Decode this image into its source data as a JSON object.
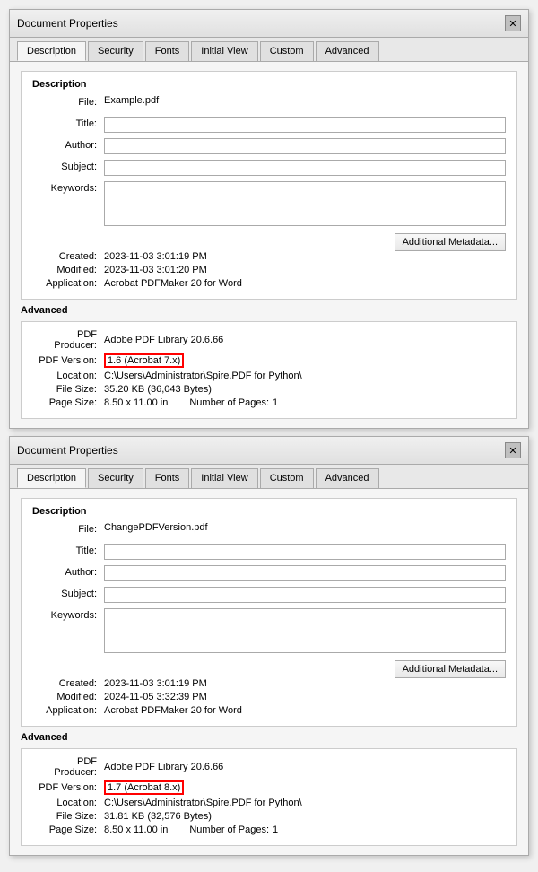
{
  "dialog1": {
    "title": "Document Properties",
    "tabs": [
      "Description",
      "Security",
      "Fonts",
      "Initial View",
      "Custom",
      "Advanced"
    ],
    "active_tab": "Description",
    "description_section_label": "Description",
    "fields": {
      "file_label": "File:",
      "file_value": "Example.pdf",
      "title_label": "Title:",
      "title_value": "",
      "author_label": "Author:",
      "author_value": "",
      "subject_label": "Subject:",
      "subject_value": "",
      "keywords_label": "Keywords:",
      "keywords_value": ""
    },
    "meta": {
      "created_label": "Created:",
      "created_value": "2023-11-03 3:01:19 PM",
      "modified_label": "Modified:",
      "modified_value": "2023-11-03 3:01:20 PM",
      "application_label": "Application:",
      "application_value": "Acrobat PDFMaker 20 for Word"
    },
    "additional_btn": "Additional Metadata...",
    "advanced_label": "Advanced",
    "advanced": {
      "pdf_producer_label": "PDF Producer:",
      "pdf_producer_value": "Adobe PDF Library 20.6.66",
      "pdf_version_label": "PDF Version:",
      "pdf_version_value": "1.6 (Acrobat 7.x)",
      "location_label": "Location:",
      "location_value": "C:\\Users\\Administrator\\Spire.PDF for Python\\",
      "file_size_label": "File Size:",
      "file_size_value": "35.20 KB (36,043 Bytes)",
      "page_size_label": "Page Size:",
      "page_size_value": "8.50 x 11.00 in",
      "number_of_pages_label": "Number of Pages:",
      "number_of_pages_value": "1"
    }
  },
  "dialog2": {
    "title": "Document Properties",
    "tabs": [
      "Description",
      "Security",
      "Fonts",
      "Initial View",
      "Custom",
      "Advanced"
    ],
    "active_tab": "Description",
    "description_section_label": "Description",
    "fields": {
      "file_label": "File:",
      "file_value": "ChangePDFVersion.pdf",
      "title_label": "Title:",
      "title_value": "",
      "author_label": "Author:",
      "author_value": "",
      "subject_label": "Subject:",
      "subject_value": "",
      "keywords_label": "Keywords:",
      "keywords_value": ""
    },
    "meta": {
      "created_label": "Created:",
      "created_value": "2023-11-03 3:01:19 PM",
      "modified_label": "Modified:",
      "modified_value": "2024-11-05 3:32:39 PM",
      "application_label": "Application:",
      "application_value": "Acrobat PDFMaker 20 for Word"
    },
    "additional_btn": "Additional Metadata...",
    "advanced_label": "Advanced",
    "advanced": {
      "pdf_producer_label": "PDF Producer:",
      "pdf_producer_value": "Adobe PDF Library 20.6.66",
      "pdf_version_label": "PDF Version:",
      "pdf_version_value": "1.7 (Acrobat 8.x)",
      "location_label": "Location:",
      "location_value": "C:\\Users\\Administrator\\Spire.PDF for Python\\",
      "file_size_label": "File Size:",
      "file_size_value": "31.81 KB (32,576 Bytes)",
      "page_size_label": "Page Size:",
      "page_size_value": "8.50 x 11.00 in",
      "number_of_pages_label": "Number of Pages:",
      "number_of_pages_value": "1"
    }
  }
}
